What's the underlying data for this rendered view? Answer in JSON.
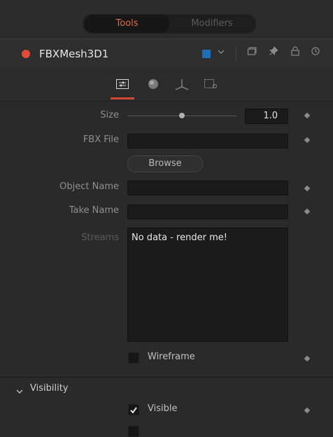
{
  "tabs": {
    "tools": "Tools",
    "modifiers": "Modifiers"
  },
  "node": {
    "name": "FBXMesh3D1",
    "color_swatch": "#1e6fb8",
    "status_color": "#e34a3a",
    "icons": [
      "color-dropdown-icon",
      "version-icon",
      "pin-icon",
      "lock-icon",
      "reset-icon"
    ]
  },
  "subtabs": [
    "controls-tab",
    "material-tab",
    "transform-tab",
    "settings-tab"
  ],
  "controls": {
    "size_label": "Size",
    "size_value": "1.0",
    "size_slider_fraction": 0.5,
    "fbx_label": "FBX File",
    "browse_label": "Browse",
    "object_label": "Object Name",
    "take_label": "Take Name",
    "streams_label": "Streams",
    "streams_text": "No data - render me!",
    "wireframe_label": "Wireframe"
  },
  "visibility": {
    "header": "Visibility",
    "visible_label": "Visible",
    "visible_checked": true
  },
  "accent": "#d04a36"
}
